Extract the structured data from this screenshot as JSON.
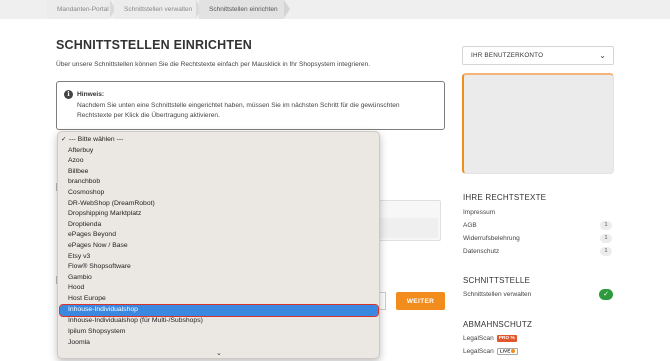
{
  "breadcrumb": {
    "items": [
      "Mandanten-Portal",
      "Schnittstellen verwalten",
      "Schnittstellen einrichten"
    ]
  },
  "main": {
    "title": "SCHNITTSTELLEN EINRICHTEN",
    "intro": "Über unsere Schnittstellen können Sie die Rechtstexte einfach per Mausklick in Ihr Shopsystem integrieren.",
    "hint": {
      "icon": "info-icon",
      "title": "Hinweis:",
      "text": "Nachdem Sie unten eine Schnittstelle eingerichtet haben, müssen Sie im nächsten Schritt für die gewünschten Rechtstexte per Klick die Übertragung aktivieren."
    },
    "weiter_label": "WEITER"
  },
  "dropdown": {
    "check": "✓",
    "options": [
      "--- Bitte wählen ---",
      "Afterbuy",
      "Azoo",
      "Billbee",
      "branchbob",
      "Cosmoshop",
      "DR-WebShop (DreamRobot)",
      "Dropshipping Marktplatz",
      "Droptienda",
      "ePages Beyond",
      "ePages Now / Base",
      "Etsy v3",
      "Flow® Shopsoftware",
      "Gambio",
      "Hood",
      "Host Europe",
      "Inhouse-Individualshop",
      "Inhouse-Individualshop (für Multi-/Subshops)",
      "Ipilum Shopsystem",
      "Joomla"
    ],
    "selected_index": 16,
    "more_arrow": "⌄"
  },
  "sidebar": {
    "account_label": "IHR BENUTZERKONTO",
    "rechtstexte": {
      "heading": "IHRE RECHTSTEXTE",
      "items": [
        {
          "label": "Impressum",
          "count": ""
        },
        {
          "label": "AGB",
          "count": "1"
        },
        {
          "label": "Widerrufsbelehrung",
          "count": "1"
        },
        {
          "label": "Datenschutz",
          "count": "1"
        }
      ]
    },
    "schnittstelle": {
      "heading": "SCHNITTSTELLE",
      "item": "Schnittstellen verwalten",
      "status": "✓"
    },
    "abmahnschutz": {
      "heading": "ABMAHNSCHUTZ",
      "items": [
        {
          "label": "LegalScan",
          "badge": "PRO %"
        },
        {
          "label": "LegalScan",
          "badge": "LIVE"
        }
      ]
    }
  },
  "colors": {
    "accent": "#f28c1c",
    "selection": "#3b88e0",
    "selection_outline": "#d9342b",
    "success": "#2e9a3e"
  }
}
